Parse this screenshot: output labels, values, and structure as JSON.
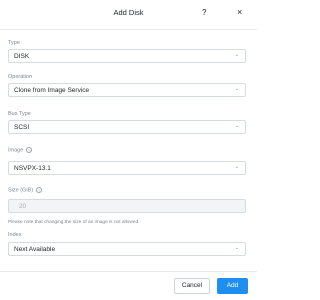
{
  "dialog": {
    "title": "Add Disk",
    "help": "?",
    "close": "×"
  },
  "fields": {
    "type": {
      "label": "Type",
      "value": "DISK"
    },
    "operation": {
      "label": "Operation",
      "value": "Clone from Image Service"
    },
    "bus_type": {
      "label": "Bus Type",
      "value": "SCSI"
    },
    "image": {
      "label": "Image",
      "value": "NSVPX-13.1"
    },
    "size": {
      "label": "Size (GiB)",
      "value": "20",
      "note": "Please note that changing the size of an image is not allowed."
    },
    "index": {
      "label": "Index",
      "value": "Next Available"
    }
  },
  "footer": {
    "cancel_label": "Cancel",
    "add_label": "Add"
  },
  "icons": {
    "info": "?",
    "chevron": "⌄"
  },
  "colors": {
    "primary": "#1f8ef1",
    "label": "#7d8793"
  }
}
